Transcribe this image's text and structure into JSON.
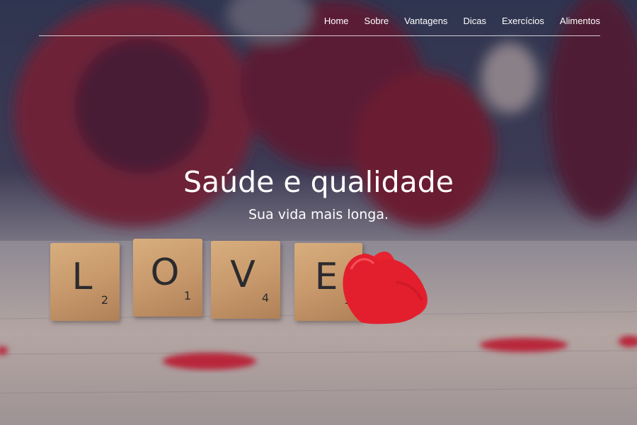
{
  "nav": {
    "items": [
      "Home",
      "Sobre",
      "Vantagens",
      "Dicas",
      "Exercícios",
      "Alimentos"
    ]
  },
  "hero": {
    "title": "Saúde e qualidade",
    "subtitle": "Sua vida mais longa."
  },
  "tiles": [
    {
      "letter": "L",
      "score": "2"
    },
    {
      "letter": "O",
      "score": "1"
    },
    {
      "letter": "V",
      "score": "4"
    },
    {
      "letter": "E",
      "score": "1"
    }
  ],
  "colors": {
    "overlay": "#2f3550",
    "rose": "#7a1f3a",
    "heart": "#e8232f",
    "tile": "#c6976a",
    "text": "#ffffff"
  },
  "icons": [
    "heart-icon"
  ]
}
